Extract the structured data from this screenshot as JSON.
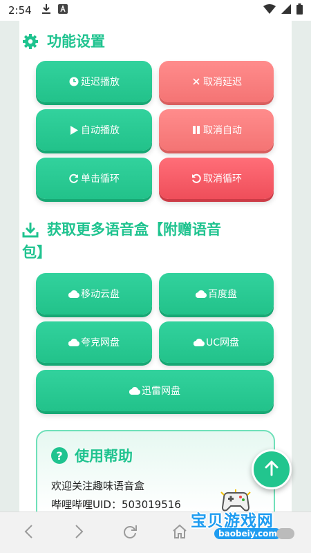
{
  "status_bar": {
    "time": "2:54",
    "icons": [
      "download-icon",
      "font-icon",
      "wifi-icon",
      "signal-icon",
      "battery-icon"
    ]
  },
  "function_section": {
    "title": "功能设置",
    "icon": "gear-icon",
    "buttons": [
      {
        "label": "延迟播放",
        "icon": "clock-icon",
        "style": "green"
      },
      {
        "label": "取消延迟",
        "icon": "close-icon",
        "style": "red"
      },
      {
        "label": "自动播放",
        "icon": "play-icon",
        "style": "green"
      },
      {
        "label": "取消自动",
        "icon": "pause-icon",
        "style": "red"
      },
      {
        "label": "单击循环",
        "icon": "redo-icon",
        "style": "green"
      },
      {
        "label": "取消循环",
        "icon": "undo-icon",
        "style": "red"
      }
    ]
  },
  "download_section": {
    "title_line1": "获取更多语音盒【附赠语音",
    "title_line2": "包】",
    "icon": "download-icon",
    "buttons": [
      {
        "label": "移动云盘",
        "icon": "cloud-icon"
      },
      {
        "label": "百度盘",
        "icon": "cloud-icon"
      },
      {
        "label": "夸克网盘",
        "icon": "cloud-icon"
      },
      {
        "label": "UC网盘",
        "icon": "cloud-icon"
      },
      {
        "label": "迅雷网盘",
        "icon": "cloud-icon"
      }
    ]
  },
  "help": {
    "title": "使用帮助",
    "icon": "question-icon",
    "lines": [
      "欢迎关注趣味语音盒",
      "哔哩哔哩UID：503019516"
    ]
  },
  "watermark": {
    "text": "宝贝游戏网",
    "url": "baobeiy.com"
  },
  "colors": {
    "accent": "#1fc38f",
    "green_button": "#26c58e",
    "red_button": "#f47474",
    "red_button_dark": "#ef4e5a",
    "background": "#e6edea"
  }
}
